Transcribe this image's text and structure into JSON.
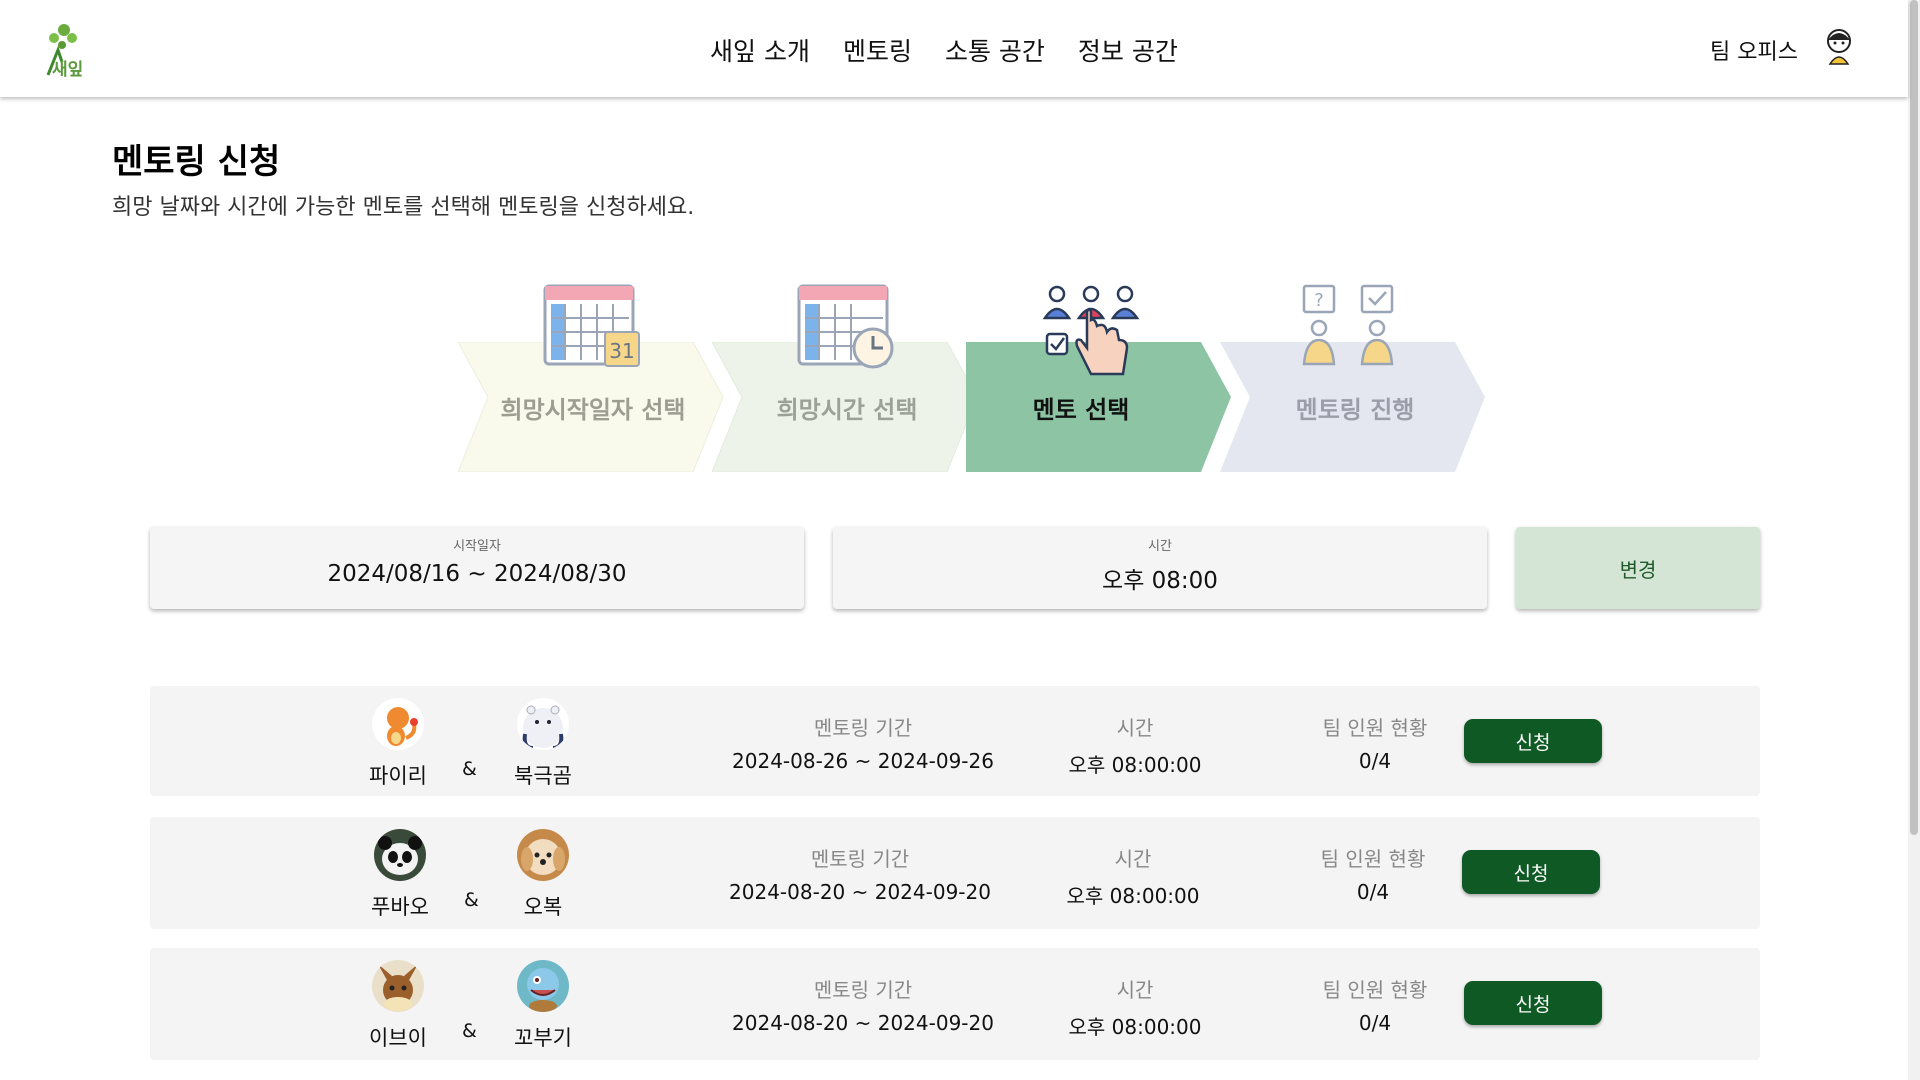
{
  "header": {
    "logo_text": "새잎",
    "nav": [
      "새잎 소개",
      "멘토링",
      "소통 공간",
      "정보 공간"
    ],
    "team_office": "팀 오피스"
  },
  "page": {
    "title": "멘토링 신청",
    "subtitle": "희망 날짜와 시간에 가능한 멘토를 선택해 멘토링을 신청하세요."
  },
  "steps": [
    {
      "label": "희망시작일자 선택",
      "color": "#f9f9ec",
      "active": false
    },
    {
      "label": "희망시간 선택",
      "color": "#eef3ea",
      "active": false
    },
    {
      "label": "멘토 선택",
      "color": "#8dc5a4",
      "active": true
    },
    {
      "label": "멘토링 진행",
      "color": "#e4e7ef",
      "active": false
    }
  ],
  "calendar_day": "31",
  "filters": {
    "start": {
      "label": "시작일자",
      "value": "2024/08/16 ~ 2024/08/30"
    },
    "time": {
      "label": "시간",
      "value": "오후 08:00"
    },
    "change_label": "변경"
  },
  "columns": {
    "period": "멘토링 기간",
    "time": "시간",
    "team": "팀 인원 현황"
  },
  "amp": "&",
  "apply_label": "신청",
  "rows": [
    {
      "mentor1": "파이리",
      "mentor2": "북극곰",
      "period": "2024-08-26 ~ 2024-09-26",
      "time": "오후 08:00:00",
      "team": "0/4"
    },
    {
      "mentor1": "푸바오",
      "mentor2": "오복",
      "period": "2024-08-20 ~ 2024-09-20",
      "time": "오후 08:00:00",
      "team": "0/4"
    },
    {
      "mentor1": "이브이",
      "mentor2": "꼬부기",
      "period": "2024-08-20 ~ 2024-09-20",
      "time": "오후 08:00:00",
      "team": "0/4"
    }
  ],
  "colors": {
    "accent": "#0f5a24",
    "active_step": "#8dc5a4",
    "change_button": "#d4e5d6"
  }
}
